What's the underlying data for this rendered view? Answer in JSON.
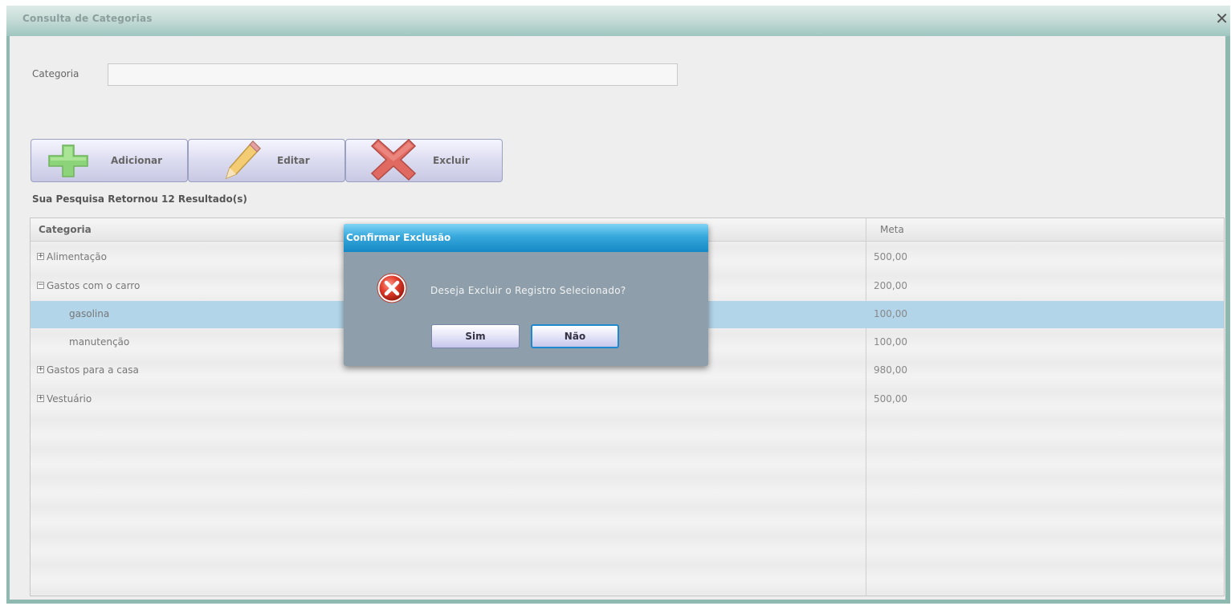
{
  "window": {
    "title": "Consulta de Categorias",
    "close_glyph": "✕"
  },
  "search": {
    "label": "Categoria",
    "value": ""
  },
  "toolbar": {
    "add_label": "Adicionar",
    "edit_label": "Editar",
    "delete_label": "Excluir"
  },
  "results_text": "Sua Pesquisa Retornou 12 Resultado(s)",
  "grid": {
    "headers": {
      "category": "Categoria",
      "meta": "Meta"
    },
    "rows": [
      {
        "category": "Alimentação",
        "meta": "500,00",
        "toggle": "+",
        "level": 0
      },
      {
        "category": "Gastos com o carro",
        "meta": "200,00",
        "toggle": "−",
        "level": 0
      },
      {
        "category": "gasolina",
        "meta": "100,00",
        "toggle": "",
        "level": 1,
        "selected": true
      },
      {
        "category": "manutenção",
        "meta": "100,00",
        "toggle": "",
        "level": 1
      },
      {
        "category": "Gastos para a casa",
        "meta": "980,00",
        "toggle": "+",
        "level": 0
      },
      {
        "category": "Vestuário",
        "meta": "500,00",
        "toggle": "+",
        "level": 0
      }
    ]
  },
  "dialog": {
    "title": "Confirmar Exclusão",
    "message": "Deseja Excluir o Registro Selecionado?",
    "yes_label": "Sim",
    "no_label": "Não",
    "icon": "error-icon"
  },
  "colors": {
    "selected_row": "#b3d5ea",
    "dialog_title": "#1688c4",
    "dialog_body": "#8e9fab"
  }
}
